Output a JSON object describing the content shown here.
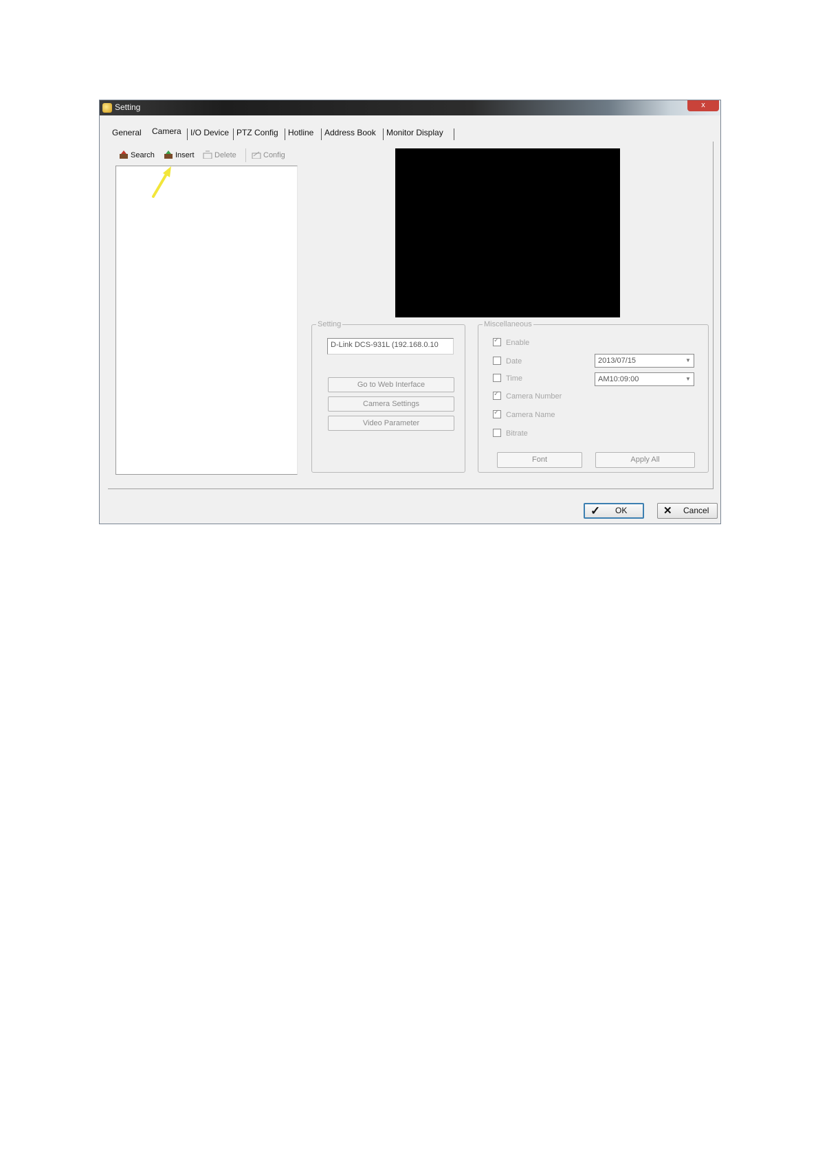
{
  "window": {
    "title": "Setting",
    "close_label": "x"
  },
  "tabs": [
    "General",
    "Camera",
    "I/O Device",
    "PTZ Config",
    "Hotline",
    "Address Book",
    "Monitor Display"
  ],
  "active_tab": "Camera",
  "toolbar": {
    "search": "Search",
    "insert": "Insert",
    "delete": "Delete",
    "config": "Config"
  },
  "setting_group": {
    "legend": "Setting",
    "camera_name": "D-Link DCS-931L (192.168.0.10",
    "buttons": [
      "Go to Web Interface",
      "Camera Settings",
      "Video Parameter"
    ]
  },
  "misc_group": {
    "legend": "Miscellaneous",
    "options": [
      {
        "label": "Enable",
        "checked": true
      },
      {
        "label": "Date",
        "checked": false
      },
      {
        "label": "Time",
        "checked": false
      },
      {
        "label": "Camera Number",
        "checked": true
      },
      {
        "label": "Camera Name",
        "checked": true
      },
      {
        "label": "Bitrate",
        "checked": false
      }
    ],
    "date_value": "2013/07/15",
    "time_value": "AM10:09:00",
    "font_button": "Font",
    "apply_all_button": "Apply All"
  },
  "footer": {
    "ok": "OK",
    "cancel": "Cancel"
  },
  "colors": {
    "annotation_arrow": "#f2e63a",
    "preview_bg": "#000000",
    "search_icon": "#c0392b",
    "insert_icon": "#3aa34a"
  }
}
